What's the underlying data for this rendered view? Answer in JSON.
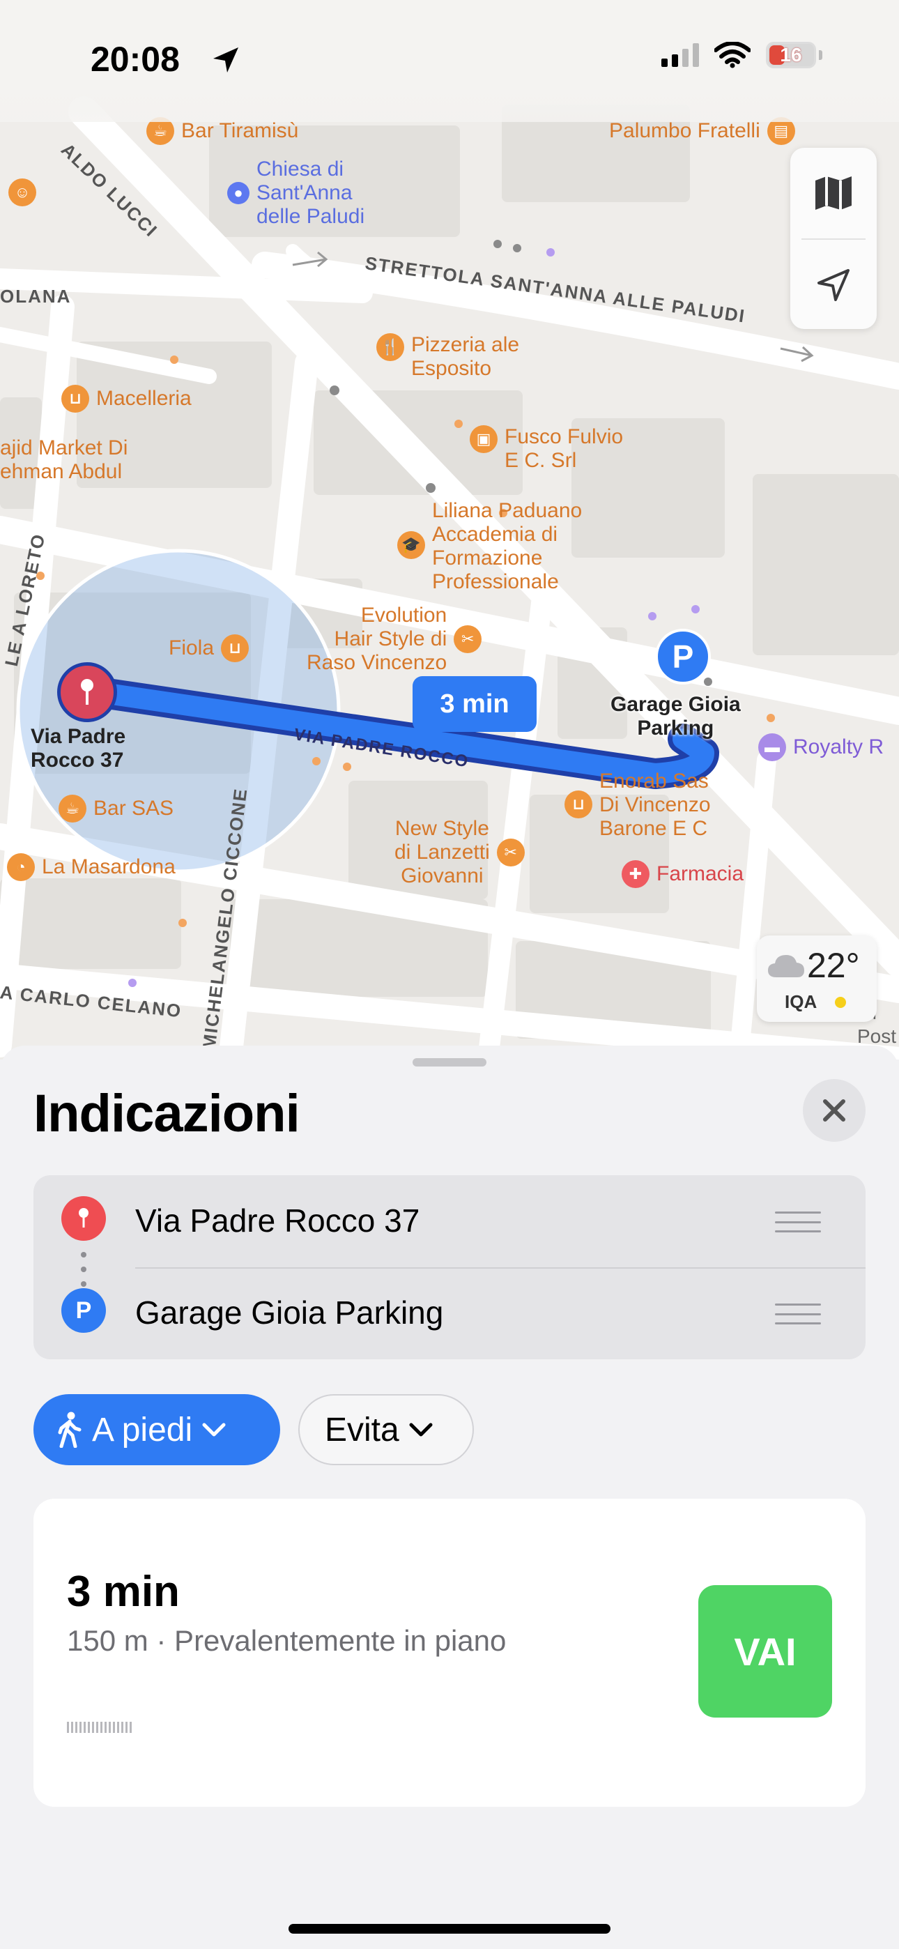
{
  "status_bar": {
    "time": "20:08",
    "battery": "16"
  },
  "map": {
    "route_duration_bubble": "3 min",
    "origin_label": "Via Padre\nRocco 37",
    "destination_label": "Garage Gioia\nParking",
    "streets": {
      "aldo_lucci": "ALDO LUCCI",
      "strettola": "STRETTOLA SANT'ANNA ALLE PALUDI",
      "olana": "OLANA",
      "padre_rocco": "VIA PADRE ROCCO",
      "loreto": "LE A LORETO",
      "ciccone": "MICHELANGELO CICCONE",
      "celano": "A CARLO CELANO"
    },
    "pois": {
      "bar_tiramisu": "Bar Tiramisù",
      "palumbo": "Palumbo Fratelli",
      "chiesa": "Chiesa di\nSant'Anna\ndelle Paludi",
      "pizzeria": "Pizzeria ale\nEsposito",
      "macelleria": "Macelleria",
      "sajid": "ajid Market Di\nehman Abdul",
      "fusco": "Fusco Fulvio\nE C. Srl",
      "liliana": "Liliana Paduano\nAccademia di\nFormazione\nProfessionale",
      "evolution": "Evolution\nHair Style di\nRaso Vincenzo",
      "fiola": "Fiola",
      "bar_sas": "Bar SAS",
      "la_masardona": "La Masardona",
      "new_style": "New Style\ndi Lanzetti\nGiovanni",
      "enorab": "Enorab Sas\nDi Vincenzo\nBarone E C",
      "farmacia": "Farmacia",
      "royalty": "Royalty R",
      "post": "ail\nPost"
    },
    "weather": {
      "temperature": "22°",
      "aqi_label": "IQA"
    }
  },
  "sheet": {
    "title": "Indicazioni",
    "stops": [
      {
        "label": "Via Padre Rocco 37",
        "marker": "pin"
      },
      {
        "label": "Garage Gioia Parking",
        "marker": "P"
      }
    ],
    "transport_mode": "A piedi",
    "avoid_label": "Evita",
    "route": {
      "duration": "3 min",
      "detail": "150 m · Prevalentemente in piano",
      "go_label": "VAI"
    }
  },
  "colors": {
    "accent": "#2F7BF3",
    "go": "#4FD464",
    "origin_pin": "#D9465B",
    "poi_orange": "#F0953A"
  }
}
